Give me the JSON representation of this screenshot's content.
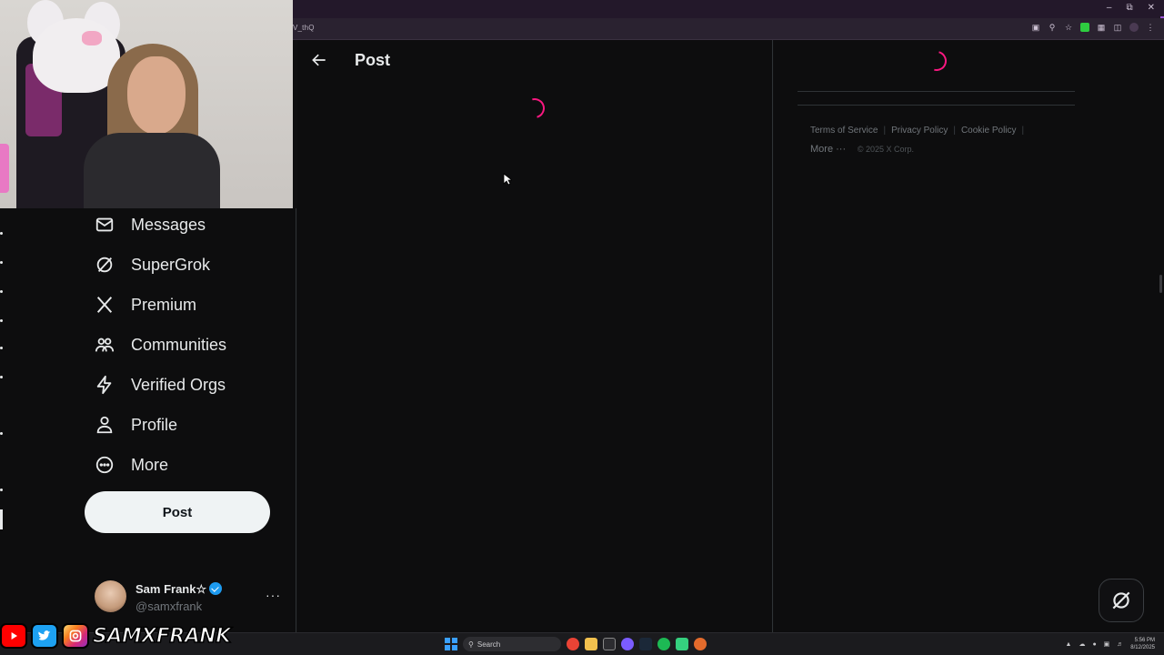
{
  "browser": {
    "url_fragment": "V_thQ"
  },
  "nav": {
    "items": [
      {
        "id": "messages",
        "label": "Messages",
        "icon": "mail-icon"
      },
      {
        "id": "supergrok",
        "label": "SuperGrok",
        "icon": "grok-icon"
      },
      {
        "id": "premium",
        "label": "Premium",
        "icon": "x-logo-icon"
      },
      {
        "id": "communities",
        "label": "Communities",
        "icon": "people-icon"
      },
      {
        "id": "verified-orgs",
        "label": "Verified Orgs",
        "icon": "lightning-icon"
      },
      {
        "id": "profile",
        "label": "Profile",
        "icon": "person-icon"
      },
      {
        "id": "more",
        "label": "More",
        "icon": "more-circle-icon"
      }
    ],
    "post_button": "Post"
  },
  "account": {
    "name": "Sam Frank☆",
    "handle": "@samxfrank",
    "more": "···"
  },
  "main": {
    "title": "Post"
  },
  "sidebar_footer": {
    "terms": "Terms of Service",
    "privacy": "Privacy Policy",
    "cookie": "Cookie Policy",
    "more": "More ···",
    "copyright": "© 2025 X Corp."
  },
  "taskbar": {
    "search": "Search",
    "time": "5:56 PM",
    "date": "8/12/2025"
  },
  "overlay": {
    "social_name": "SAMXFRANK"
  },
  "colors": {
    "accent_pink": "#f91880",
    "verified_blue": "#1d9bf0",
    "background": "#0d0d0e",
    "border": "#2f3336"
  }
}
